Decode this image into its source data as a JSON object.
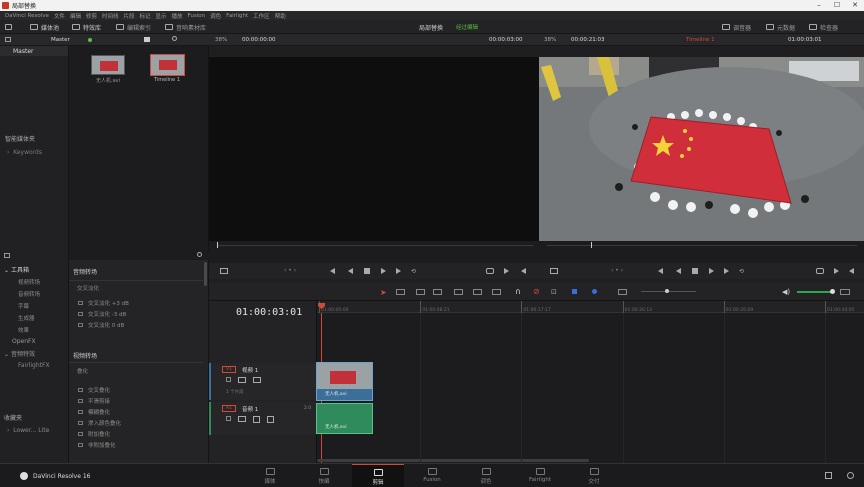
{
  "window": {
    "title": "局部替换"
  },
  "menu": [
    "DaVinci Resolve",
    "文件",
    "编辑",
    "修剪",
    "时间线",
    "片段",
    "标记",
    "显示",
    "播放",
    "Fusion",
    "调色",
    "Fairlight",
    "工作区",
    "帮助"
  ],
  "toolbar": {
    "media_pool": "媒体池",
    "effects_library": "特效库",
    "edit_index": "编辑索引",
    "sound_library": "音响素材库",
    "project_title": "局部替换",
    "edited_status": "经过编辑",
    "mixer": "调音器",
    "metadata": "元数据",
    "inspector": "检查器"
  },
  "subbar": {
    "master_label": "Master",
    "src_zoom": "38%",
    "src_timecode": "00:00:00:00",
    "src_duration": "00:00:03:00",
    "prg_zoom": "38%",
    "prg_timecode": "00:00:21:03",
    "timeline_name": "Timeline 1",
    "prg_tc": "01:00:03:01"
  },
  "bins": {
    "master": "Master",
    "smart_bins": "智能媒体夹",
    "keywords": "Keywords"
  },
  "clips": [
    {
      "name": "无人机.avi"
    },
    {
      "name": "Timeline 1"
    }
  ],
  "effects_tree": {
    "toolbox": "工具箱",
    "items": [
      "视频转场",
      "音频转场",
      "字幕",
      "生成器",
      "效果"
    ],
    "openfx": "OpenFX",
    "audio_fx": "音频特效",
    "fairlight_fx": "FairlightFX",
    "favorites": "收藏夹",
    "fav_item": "Lower... Lite"
  },
  "effects_list": {
    "audio_transitions": "音频转场",
    "crossfade_header": "交叉淡化",
    "crossfades": [
      "交叉淡化 +3 dB",
      "交叉淡化 -3 dB",
      "交叉淡化 0 dB"
    ],
    "video_transitions": "视频转场",
    "dissolve_header": "叠化",
    "dissolves": [
      "交叉叠化",
      "平滑剪接",
      "模糊叠化",
      "渗入颜色叠化",
      "附加叠化",
      "非附加叠化"
    ]
  },
  "timeline": {
    "timecode": "01:00:03:01",
    "ruler_labels": [
      "01:00:00:00",
      "01:00:08:21",
      "01:00:17:17",
      "01:00:26:13",
      "01:00:35:09",
      "01:00:44:05"
    ],
    "video_track": {
      "tag": "V1",
      "name": "视频 1",
      "clip_count": "1 个片段",
      "clip_name": "无人机.avi"
    },
    "audio_track": {
      "tag": "A1",
      "name": "音频 1",
      "level": "2.0",
      "clip_name": "无人机.avi"
    }
  },
  "pages": [
    "媒体",
    "快编",
    "剪辑",
    "Fusion",
    "调色",
    "Fairlight",
    "交付"
  ],
  "app_name": "DaVinci Resolve 16",
  "colors": {
    "accent": "#d04a3a",
    "video_clip": "#3b6e98",
    "audio_clip": "#2f8a5c",
    "edited": "#5fbf3f"
  }
}
